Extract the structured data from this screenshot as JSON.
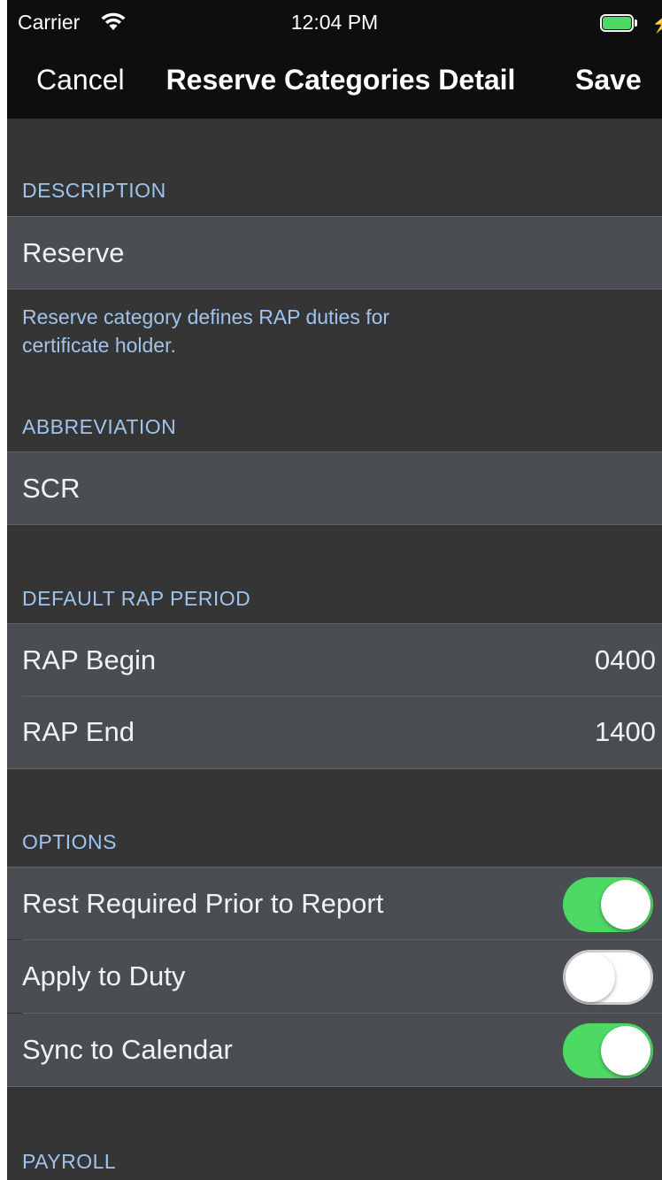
{
  "status_bar": {
    "carrier": "Carrier",
    "time": "12:04 PM"
  },
  "nav": {
    "cancel": "Cancel",
    "title": "Reserve Categories Detail",
    "save": "Save"
  },
  "sections": {
    "description": {
      "header": "DESCRIPTION",
      "value": "Reserve",
      "footer_line1": "Reserve category defines RAP duties for",
      "footer_line2": "certificate holder."
    },
    "abbreviation": {
      "header": "ABBREVIATION",
      "value": "SCR"
    },
    "rap_period": {
      "header": "DEFAULT RAP PERIOD",
      "rows": [
        {
          "label": "RAP Begin",
          "value": "0400"
        },
        {
          "label": "RAP End",
          "value": "1400"
        }
      ]
    },
    "options": {
      "header": "OPTIONS",
      "rows": [
        {
          "label": "Rest Required Prior to Report",
          "on": true
        },
        {
          "label": "Apply to Duty",
          "on": false
        },
        {
          "label": "Sync to Calendar",
          "on": true
        }
      ]
    },
    "payroll": {
      "header": "PAYROLL"
    }
  },
  "colors": {
    "background": "#353535",
    "cell": "#4a4e53",
    "header_text": "#9ec4ee",
    "toggle_on": "#4cd964",
    "nav_bar": "#0e0e0e"
  }
}
